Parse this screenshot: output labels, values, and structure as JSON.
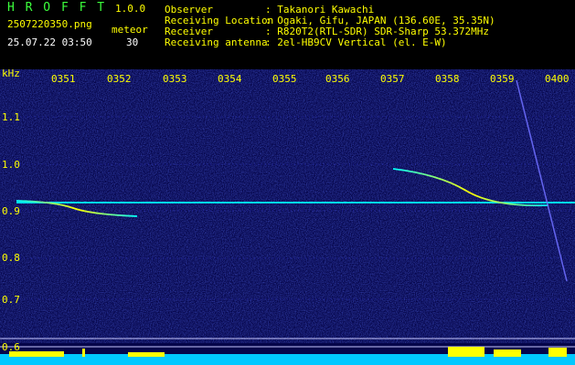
{
  "app": {
    "name": "H R O F F T",
    "version": "1.0.0",
    "filename": "2507220350.png",
    "datetime": "25.07.22 03:50",
    "mode_label": "meteor",
    "mode_value": "30"
  },
  "info": [
    {
      "label": "Observer",
      "value": ": Takanori Kawachi"
    },
    {
      "label": "Receiving Location",
      "value": ": Ogaki, Gifu, JAPAN (136.60E, 35.35N)"
    },
    {
      "label": "Receiver",
      "value": ": R820T2(RTL-SDR) SDR-Sharp 53.372MHz"
    },
    {
      "label": "Receiving antenna",
      "value": ": 2el-HB9CV Vertical (el. E-W)"
    }
  ],
  "axis": {
    "unit": "kHz",
    "x_ticks": [
      "0351",
      "0352",
      "0353",
      "0354",
      "0355",
      "0356",
      "0357",
      "0358",
      "0359",
      "0400"
    ],
    "y_ticks": [
      "1.1",
      "1.0",
      "0.9",
      "0.8",
      "0.7",
      "0.6"
    ]
  },
  "colors": {
    "bg": "#05054a",
    "carrier": "#00ffff",
    "echo": "#ffff00",
    "header_yellow": "#ffff00",
    "header_green": "#3cff3c"
  }
}
